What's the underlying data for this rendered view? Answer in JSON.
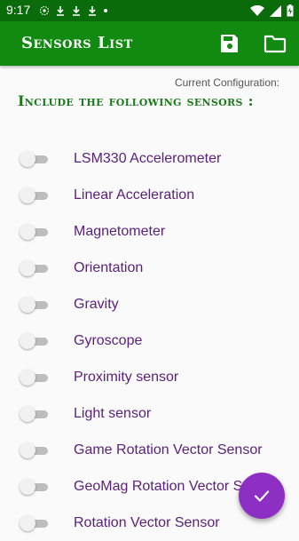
{
  "status_bar": {
    "time": "9:17",
    "left_icons": [
      "settings-gear-notification-icon",
      "download-icon",
      "download-icon",
      "download-icon",
      "dot-icon"
    ],
    "right_icons": [
      "wifi-icon",
      "signal-icon",
      "battery-charging-icon"
    ]
  },
  "app_bar": {
    "title": "Sensors List",
    "actions": [
      "save-icon",
      "folder-icon"
    ]
  },
  "config_label": "Current Configuration:",
  "section_heading": "Include the following sensors :",
  "sensors": [
    {
      "label": "LSM330 Accelerometer",
      "enabled": false
    },
    {
      "label": "Linear Acceleration",
      "enabled": false
    },
    {
      "label": "Magnetometer",
      "enabled": false
    },
    {
      "label": "Orientation",
      "enabled": false
    },
    {
      "label": "Gravity",
      "enabled": false
    },
    {
      "label": "Gyroscope",
      "enabled": false
    },
    {
      "label": "Proximity sensor",
      "enabled": false
    },
    {
      "label": "Light sensor",
      "enabled": false
    },
    {
      "label": "Game Rotation Vector Sensor",
      "enabled": false
    },
    {
      "label": "GeoMag Rotation Vector Sensor",
      "enabled": false
    },
    {
      "label": "Rotation Vector Sensor",
      "enabled": false
    }
  ],
  "fab": {
    "icon": "check-icon"
  },
  "colors": {
    "status_bar": "#0a6b0a",
    "app_bar": "#128a12",
    "heading": "#1b7a1b",
    "sensor_text": "#5a1f7a",
    "fab": "#8e2fc4"
  }
}
